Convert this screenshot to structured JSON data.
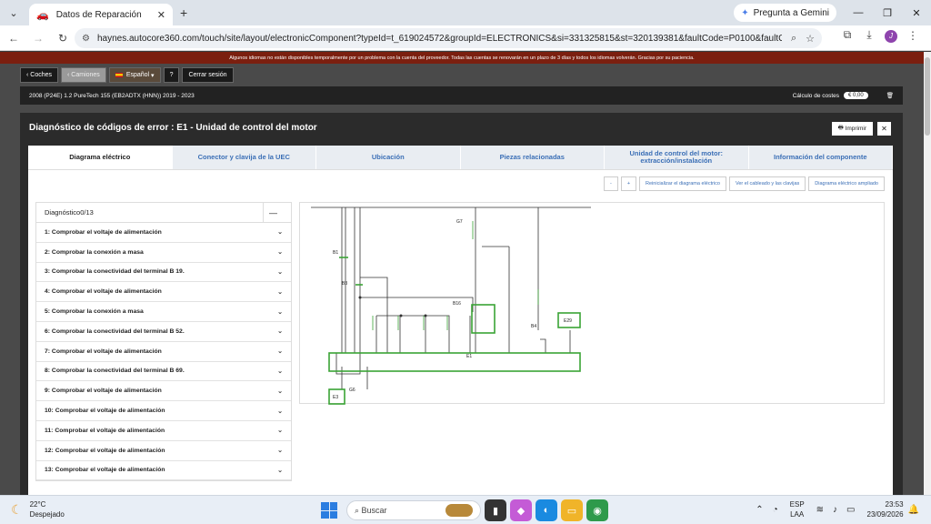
{
  "browser": {
    "tab_title": "Datos de Reparación",
    "gemini_label": "Pregunta a Gemini",
    "url": "haynes.autocore360.com/touch/site/layout/electronicComponent?typeId=t_619024572&groupId=ELECTRONICS&si=331325815&st=320139381&faultCode=P0100&faultCodes=P0..."
  },
  "notice": "Algunos idiomas no están disponibles temporalmente por un problema con la cuenta del proveedor. Todas las cuentas se renovarán en un plazo de 3 días y todos los idiomas volverán. Gracias por su paciencia.",
  "topnav": {
    "cars": "Coches",
    "trucks": "Camiones",
    "language": "Español",
    "help": "?",
    "logout": "Cerrar sesión"
  },
  "vehicle": {
    "description": "2008 (P24E) 1.2 PureTech 155 (EB2ADTX (HNN)) 2019 - 2023",
    "cost_label": "Cálculo de costes",
    "cost_value": "0,00"
  },
  "panel": {
    "title": "Diagnóstico de códigos de error : E1 - Unidad de control del motor",
    "print": "Imprimir"
  },
  "tabs": [
    "Diagrama eléctrico",
    "Conector y clavija de la UEC",
    "Ubicación",
    "Piezas relacionadas",
    "Unidad de control del motor: extracción/instalación",
    "Información del componente"
  ],
  "tools": {
    "zoom_out": "-",
    "zoom_in": "+",
    "reset": "Reinicializar el diagrama eléctrico",
    "wiring": "Ver el cableado y las clavijas",
    "expanded": "Diagrama eléctrico ampliado"
  },
  "diagnostics": {
    "header": "Diagnóstico0/13",
    "items": [
      "1: Comprobar el voltaje de alimentación",
      "2: Comprobar la conexión a masa",
      "3: Comprobar la conectividad del terminal B 19.",
      "4: Comprobar el voltaje de alimentación",
      "5: Comprobar la conexión a masa",
      "6: Comprobar la conectividad del terminal B 52.",
      "7: Comprobar el voltaje de alimentación",
      "8: Comprobar la conectividad del terminal B 69.",
      "9: Comprobar el voltaje de alimentación",
      "10: Comprobar el voltaje de alimentación",
      "11: Comprobar el voltaje de alimentación",
      "12: Comprobar el voltaje de alimentación",
      "13: Comprobar el voltaje de alimentación"
    ]
  },
  "diagram_labels": {
    "e1": "E1",
    "e3": "E3",
    "e29": "E29",
    "b1": "B1",
    "b3": "B3",
    "b4": "B4",
    "b16": "B16",
    "g6": "G6",
    "g7": "G7"
  },
  "taskbar": {
    "temp": "22°C",
    "weather": "Despejado",
    "search": "Buscar",
    "lang1": "ESP",
    "lang2": "LAA",
    "time": "23:53",
    "date": "23/09/2026"
  }
}
